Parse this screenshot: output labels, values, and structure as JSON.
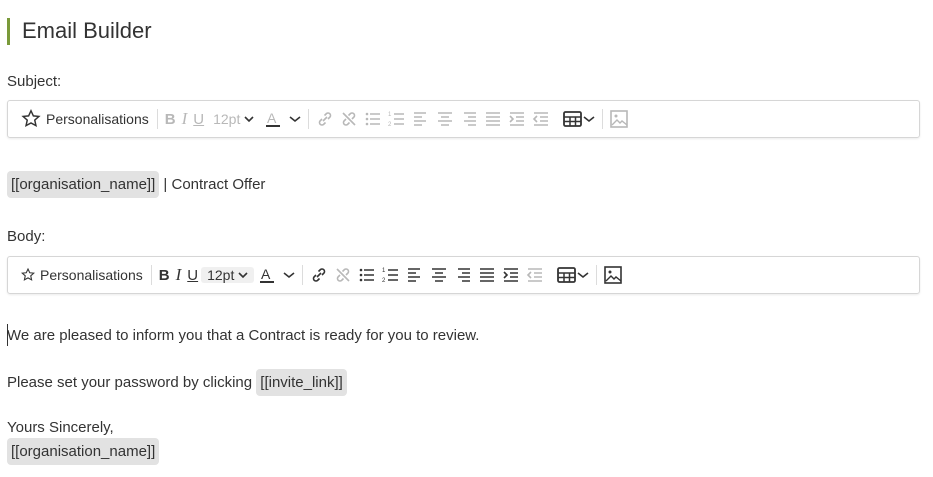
{
  "header": {
    "title": "Email Builder"
  },
  "subject": {
    "label": "Subject:",
    "toolbar": {
      "personalisations": "Personalisations",
      "font_size": "12pt"
    },
    "content": {
      "tag": "[[organisation_name]]",
      "suffix": " | Contract Offer"
    }
  },
  "body": {
    "label": "Body:",
    "toolbar": {
      "personalisations": "Personalisations",
      "font_size": "12pt"
    },
    "content": {
      "line1": "We are pleased to inform you that a Contract is ready for you to review.",
      "line2_prefix": "Please set your password by clicking ",
      "line2_tag": "[[invite_link]]",
      "line3": "Yours Sincerely,",
      "line4_tag": "[[organisation_name]]"
    }
  },
  "colors": {
    "accent": "#7a9a3a",
    "tag_bg": "#e2e2e2",
    "disabled": "#b8b8b8"
  }
}
